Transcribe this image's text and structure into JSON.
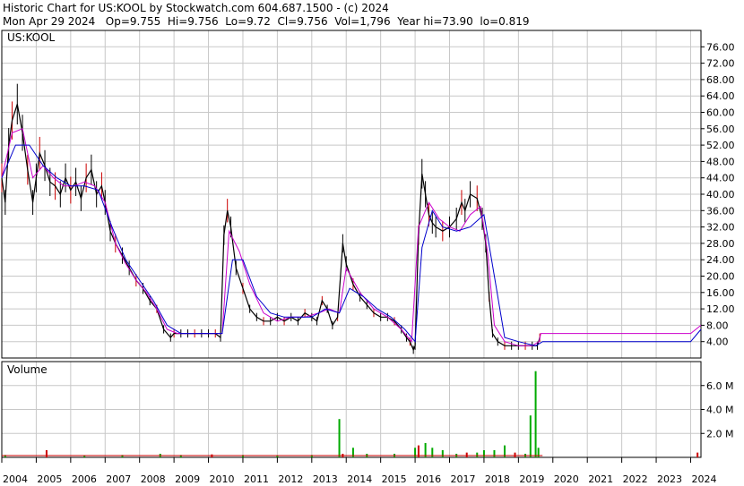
{
  "header": {
    "line1": "Historic Chart for US:KOOL by Stockwatch.com 604.687.1500 - (c) 2024",
    "line2": "Mon Apr 29 2024   Op=9.755  Hi=9.756  Lo=9.72  Cl=9.756  Vol=1,796  Year hi=73.90  lo=0.819"
  },
  "price_panel_label": "US:KOOL",
  "volume_panel_label": "Volume",
  "colors": {
    "price": "#000000",
    "price_up": "#cc0000",
    "ma_short": "#cc00cc",
    "ma_long": "#0000cc",
    "volume": "#00aa00",
    "volume_down": "#cc0000",
    "grid": "#c8c8c8",
    "axis": "#000000"
  },
  "chart_data": [
    {
      "type": "line",
      "title": "",
      "xlabel": "",
      "ylabel": "",
      "ylim": [
        0,
        80
      ],
      "xlim": [
        2004.0,
        2024.3
      ],
      "grid": true,
      "y_ticks": [
        "4.00",
        "8.00",
        "12.00",
        "16.00",
        "20.00",
        "24.00",
        "28.00",
        "32.00",
        "36.00",
        "40.00",
        "44.00",
        "48.00",
        "52.00",
        "56.00",
        "60.00",
        "64.00",
        "68.00",
        "72.00",
        "76.00"
      ],
      "x_ticks": [
        "2004",
        "2005",
        "2006",
        "2007",
        "2008",
        "2009",
        "2010",
        "2011",
        "2012",
        "2013",
        "2014",
        "2015",
        "2016",
        "2017",
        "2018",
        "2019",
        "2020",
        "2021",
        "2022",
        "2023",
        "2024"
      ],
      "series": [
        {
          "role": "price",
          "x": [
            2004.0,
            2004.1,
            2004.2,
            2004.3,
            2004.45,
            2004.6,
            2004.75,
            2004.9,
            2005.0,
            2005.1,
            2005.25,
            2005.4,
            2005.55,
            2005.7,
            2005.85,
            2006.0,
            2006.15,
            2006.3,
            2006.45,
            2006.6,
            2006.75,
            2006.9,
            2007.0,
            2007.15,
            2007.3,
            2007.5,
            2007.7,
            2007.9,
            2008.1,
            2008.3,
            2008.5,
            2008.7,
            2008.9,
            2009.0,
            2009.2,
            2009.4,
            2009.6,
            2009.8,
            2010.0,
            2010.2,
            2010.35,
            2010.45,
            2010.55,
            2010.65,
            2010.8,
            2011.0,
            2011.2,
            2011.4,
            2011.6,
            2011.8,
            2012.0,
            2012.2,
            2012.4,
            2012.6,
            2012.8,
            2013.0,
            2013.15,
            2013.3,
            2013.45,
            2013.6,
            2013.75,
            2013.9,
            2014.0,
            2014.2,
            2014.4,
            2014.6,
            2014.8,
            2015.0,
            2015.2,
            2015.4,
            2015.6,
            2015.75,
            2015.85,
            2015.95,
            2016.0,
            2016.1,
            2016.2,
            2016.3,
            2016.4,
            2016.5,
            2016.6,
            2016.8,
            2017.0,
            2017.2,
            2017.35,
            2017.45,
            2017.6,
            2017.8,
            2017.95,
            2018.05,
            2018.15,
            2018.25,
            2018.4,
            2018.6,
            2018.8,
            2019.0,
            2019.2,
            2019.4,
            2019.55,
            2019.62
          ],
          "y": [
            44,
            38,
            52,
            58,
            62,
            55,
            46,
            38,
            44,
            50,
            47,
            43,
            42,
            40,
            44,
            41,
            43,
            39,
            44,
            46,
            40,
            42,
            38,
            31,
            28,
            25,
            22,
            19,
            17,
            14,
            12,
            7,
            5,
            6,
            6,
            6,
            6,
            6,
            6,
            6,
            5,
            30,
            36,
            32,
            22,
            17,
            12,
            10,
            9,
            9,
            10,
            9,
            10,
            9,
            11,
            10,
            9,
            14,
            12,
            8,
            10,
            28,
            23,
            18,
            15,
            13,
            11,
            10,
            10,
            9,
            7,
            5,
            4,
            2,
            3,
            30,
            45,
            40,
            35,
            33,
            32,
            31,
            32,
            34,
            38,
            36,
            40,
            39,
            34,
            28,
            15,
            6,
            4,
            3,
            3,
            3,
            3,
            3,
            3,
            5
          ]
        },
        {
          "role": "ma_short",
          "x": [
            2004.0,
            2004.3,
            2004.6,
            2004.9,
            2005.2,
            2005.5,
            2005.8,
            2006.1,
            2006.4,
            2006.7,
            2007.0,
            2007.3,
            2007.6,
            2007.9,
            2008.2,
            2008.5,
            2008.8,
            2009.1,
            2009.5,
            2010.0,
            2010.4,
            2010.6,
            2010.9,
            2011.2,
            2011.6,
            2012.0,
            2012.4,
            2012.8,
            2013.2,
            2013.5,
            2013.8,
            2014.0,
            2014.4,
            2014.8,
            2015.2,
            2015.6,
            2015.9,
            2016.1,
            2016.4,
            2016.7,
            2017.0,
            2017.3,
            2017.6,
            2017.9,
            2018.1,
            2018.3,
            2018.6,
            2019.0,
            2019.4,
            2019.6,
            2019.65,
            2024.0,
            2024.3
          ],
          "y": [
            44,
            55,
            56,
            44,
            47,
            44,
            42,
            42,
            43,
            42,
            38,
            28,
            23,
            19,
            16,
            12,
            7,
            6,
            6,
            6,
            6,
            31,
            26,
            18,
            11,
            9,
            10,
            10,
            11,
            12,
            11,
            22,
            16,
            12,
            10,
            7,
            4,
            32,
            38,
            34,
            32,
            31,
            35,
            37,
            26,
            8,
            4,
            3,
            3,
            4,
            6,
            6,
            8
          ]
        },
        {
          "role": "ma_long",
          "x": [
            2004.0,
            2004.4,
            2004.8,
            2005.2,
            2005.6,
            2006.0,
            2006.4,
            2006.8,
            2007.2,
            2007.6,
            2008.0,
            2008.4,
            2008.8,
            2009.2,
            2009.6,
            2010.0,
            2010.4,
            2010.7,
            2011.0,
            2011.4,
            2011.8,
            2012.2,
            2012.6,
            2013.0,
            2013.4,
            2013.8,
            2014.1,
            2014.5,
            2014.9,
            2015.3,
            2015.7,
            2016.0,
            2016.2,
            2016.5,
            2016.8,
            2017.2,
            2017.6,
            2018.0,
            2018.3,
            2018.6,
            2019.0,
            2019.5,
            2019.7,
            2024.0,
            2024.3
          ],
          "y": [
            44,
            52,
            52,
            47,
            44,
            42,
            42,
            41,
            32,
            24,
            19,
            14,
            8,
            6,
            6,
            6,
            6,
            24,
            24,
            15,
            11,
            10,
            10,
            10,
            12,
            11,
            17,
            15,
            12,
            10,
            7,
            4,
            27,
            36,
            32,
            31,
            32,
            35,
            20,
            5,
            4,
            3,
            4,
            4,
            7
          ]
        }
      ]
    },
    {
      "type": "bar",
      "title": "",
      "xlabel": "",
      "ylabel": "",
      "ylim": [
        0,
        8
      ],
      "grid": true,
      "y_ticks": [
        "2.0 M",
        "4.0 M",
        "6.0 M"
      ],
      "series": [
        {
          "name": "",
          "x": [
            2004.1,
            2005.3,
            2006.4,
            2007.5,
            2008.6,
            2009.2,
            2010.1,
            2011.0,
            2012.0,
            2013.0,
            2013.8,
            2013.9,
            2014.2,
            2014.6,
            2015.4,
            2016.0,
            2016.1,
            2016.3,
            2016.5,
            2016.8,
            2017.2,
            2017.5,
            2017.8,
            2018.0,
            2018.3,
            2018.6,
            2018.9,
            2019.2,
            2019.35,
            2019.5,
            2019.58,
            2024.2
          ],
          "values": [
            0.2,
            0.6,
            0.15,
            0.2,
            0.3,
            0.2,
            0.25,
            0.2,
            0.15,
            0.2,
            3.2,
            0.3,
            0.8,
            0.3,
            0.3,
            0.8,
            1.0,
            1.2,
            0.8,
            0.6,
            0.3,
            0.4,
            0.4,
            0.6,
            0.6,
            1.0,
            0.4,
            0.3,
            3.5,
            7.2,
            0.8,
            0.4
          ]
        }
      ]
    }
  ]
}
